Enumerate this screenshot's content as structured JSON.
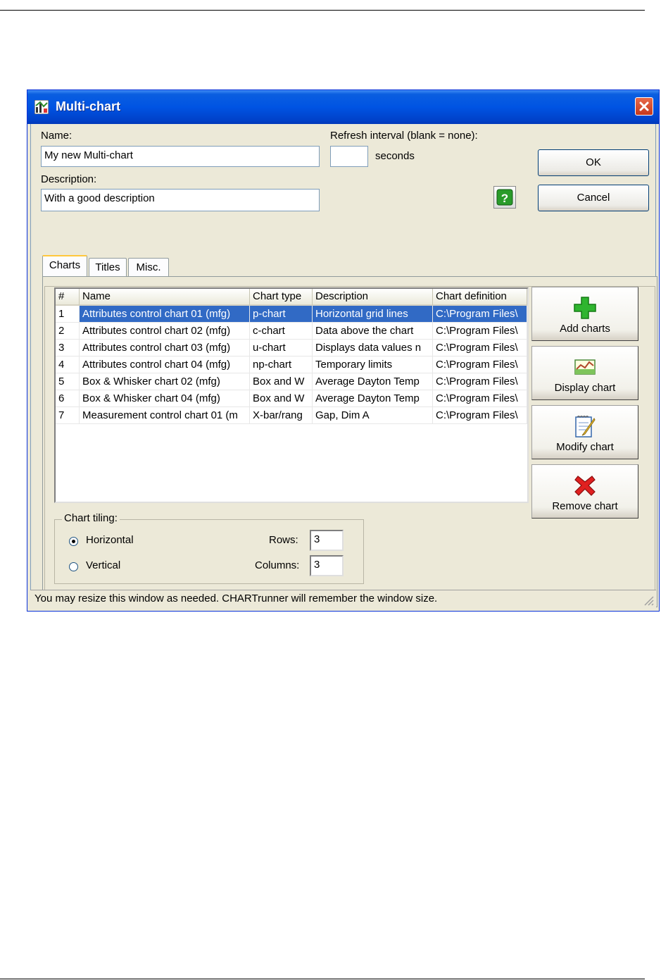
{
  "window": {
    "title": "Multi-chart",
    "status_text": "You may resize this window as needed. CHARTrunner will remember the window size."
  },
  "form": {
    "name_label": "Name:",
    "name_value": "My new Multi-chart",
    "description_label": "Description:",
    "description_value": "With a good description",
    "refresh_label": "Refresh interval (blank = none):",
    "refresh_value": "",
    "refresh_unit": "seconds",
    "ok_label": "OK",
    "cancel_label": "Cancel"
  },
  "tabs": [
    {
      "label": "Charts",
      "active": true
    },
    {
      "label": "Titles",
      "active": false
    },
    {
      "label": "Misc.",
      "active": false
    }
  ],
  "table": {
    "columns": [
      "#",
      "Name",
      "Chart type",
      "Description",
      "Chart definition"
    ],
    "rows": [
      {
        "num": "1",
        "name": "Attributes control chart 01 (mfg)",
        "type": "p-chart",
        "description": "Horizontal grid lines",
        "definition": "C:\\Program Files\\",
        "selected": true
      },
      {
        "num": "2",
        "name": "Attributes control chart 02 (mfg)",
        "type": "c-chart",
        "description": "Data above the chart",
        "definition": "C:\\Program Files\\",
        "selected": false
      },
      {
        "num": "3",
        "name": "Attributes control chart 03 (mfg)",
        "type": "u-chart",
        "description": "Displays data values n",
        "definition": "C:\\Program Files\\",
        "selected": false
      },
      {
        "num": "4",
        "name": "Attributes control chart 04 (mfg)",
        "type": "np-chart",
        "description": "Temporary limits",
        "definition": "C:\\Program Files\\",
        "selected": false
      },
      {
        "num": "5",
        "name": "Box & Whisker chart 02 (mfg)",
        "type": "Box and W",
        "description": "Average Dayton Temp",
        "definition": "C:\\Program Files\\",
        "selected": false
      },
      {
        "num": "6",
        "name": "Box & Whisker chart 04 (mfg)",
        "type": "Box and W",
        "description": "Average Dayton Temp",
        "definition": "C:\\Program Files\\",
        "selected": false
      },
      {
        "num": "7",
        "name": "Measurement control chart 01 (m",
        "type": "X-bar/rang",
        "description": "Gap, Dim A",
        "definition": "C:\\Program Files\\",
        "selected": false
      }
    ]
  },
  "side_buttons": {
    "add": "Add charts",
    "display": "Display chart",
    "modify": "Modify chart",
    "remove": "Remove chart"
  },
  "tiling": {
    "title": "Chart tiling:",
    "horizontal_label": "Horizontal",
    "vertical_label": "Vertical",
    "selected": "Horizontal",
    "rows_label": "Rows:",
    "rows_value": "3",
    "columns_label": "Columns:",
    "columns_value": "3"
  },
  "colors": {
    "title_bar": "#0054e3",
    "selection": "#316ac5",
    "dialog_bg": "#ece9d8"
  }
}
